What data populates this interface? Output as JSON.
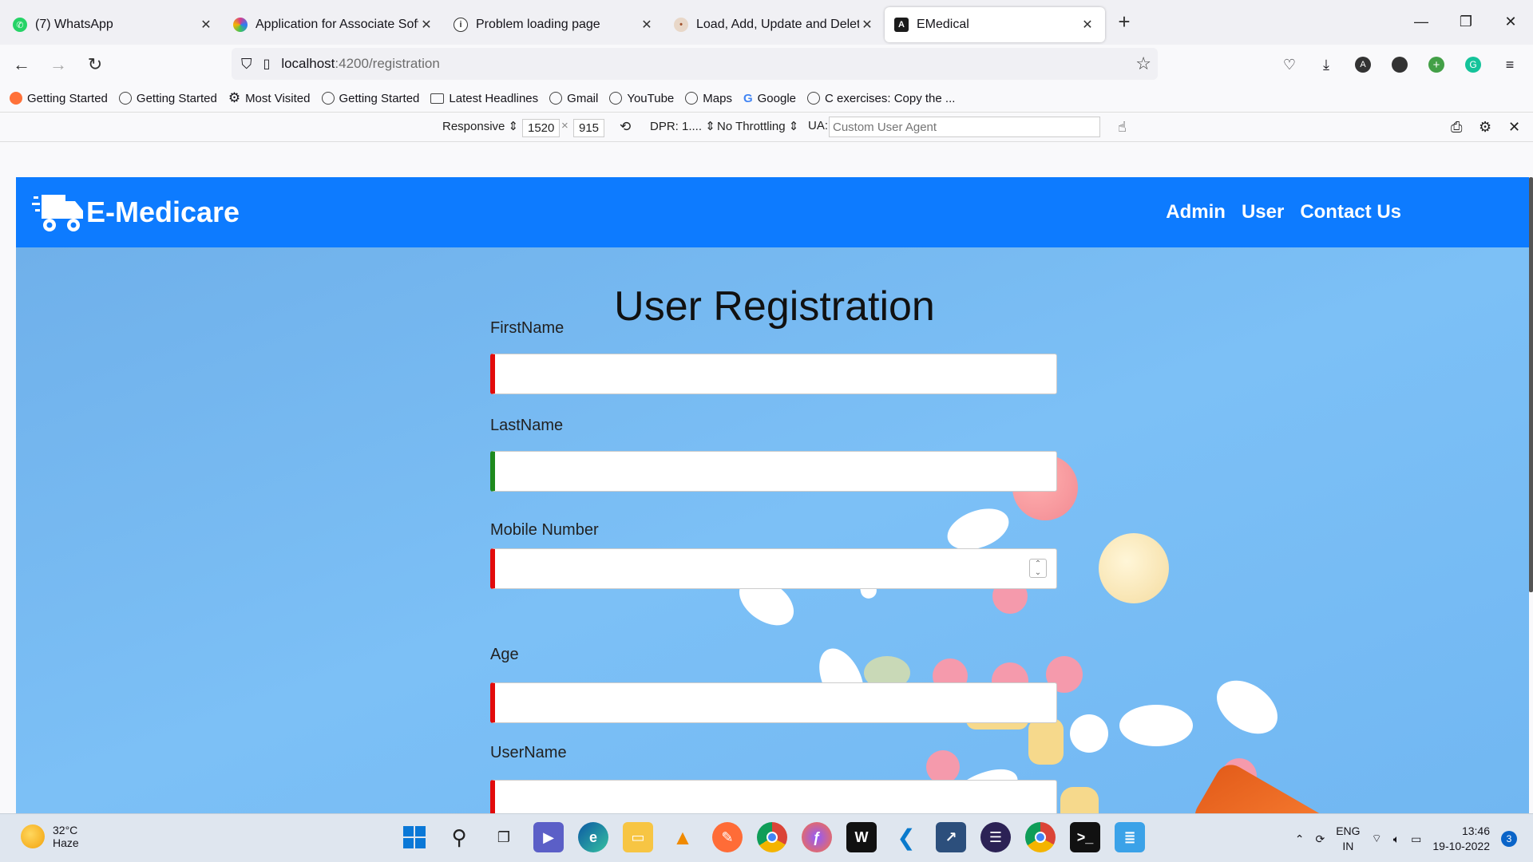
{
  "browser": {
    "tabs": [
      {
        "label": "(7) WhatsApp",
        "icon": "whatsapp-icon",
        "color": "#25d366"
      },
      {
        "label": "Application for Associate Softw",
        "icon": "app-icon",
        "color": "#d93b8a"
      },
      {
        "label": "Problem loading page",
        "icon": "info-icon",
        "color": "#444444"
      },
      {
        "label": "Load, Add, Update and Delete",
        "icon": "page-icon",
        "color": "#a0522d"
      },
      {
        "label": "EMedical",
        "icon": "angular-icon",
        "color": "#1b1b1b"
      }
    ],
    "active_tab": 4,
    "url": {
      "host": "localhost",
      "path": ":4200/registration"
    },
    "bookmarks": [
      "Getting Started",
      "Getting Started",
      "Most Visited",
      "Getting Started",
      "Latest Headlines",
      "Gmail",
      "YouTube",
      "Maps",
      "Google",
      "C exercises: Copy the ..."
    ],
    "devtools": {
      "mode": "Responsive",
      "width": "1520",
      "height": "915",
      "dpr": "DPR: 1....",
      "throttling": "No Throttling",
      "ua_label": "UA:",
      "ua_placeholder": "Custom User Agent"
    }
  },
  "page": {
    "brand": "E-Medicare",
    "nav": [
      "Admin",
      "User",
      "Contact Us"
    ],
    "title": "User Registration",
    "fields": [
      {
        "label": "FirstName",
        "state": "invalid",
        "value": ""
      },
      {
        "label": "LastName",
        "state": "valid",
        "value": ""
      },
      {
        "label": "Mobile Number",
        "state": "invalid",
        "value": ""
      },
      {
        "label": "Age",
        "state": "invalid",
        "value": ""
      },
      {
        "label": "UserName",
        "state": "invalid",
        "value": ""
      }
    ],
    "colors": {
      "header": "#0d7bff",
      "invalid": "#e30b0b",
      "valid": "#1e8a1e"
    }
  },
  "taskbar": {
    "weather": {
      "temp": "32°C",
      "condition": "Haze"
    },
    "lang": {
      "top": "ENG",
      "bottom": "IN"
    },
    "time": "13:46",
    "date": "19-10-2022",
    "notifications": "3"
  }
}
